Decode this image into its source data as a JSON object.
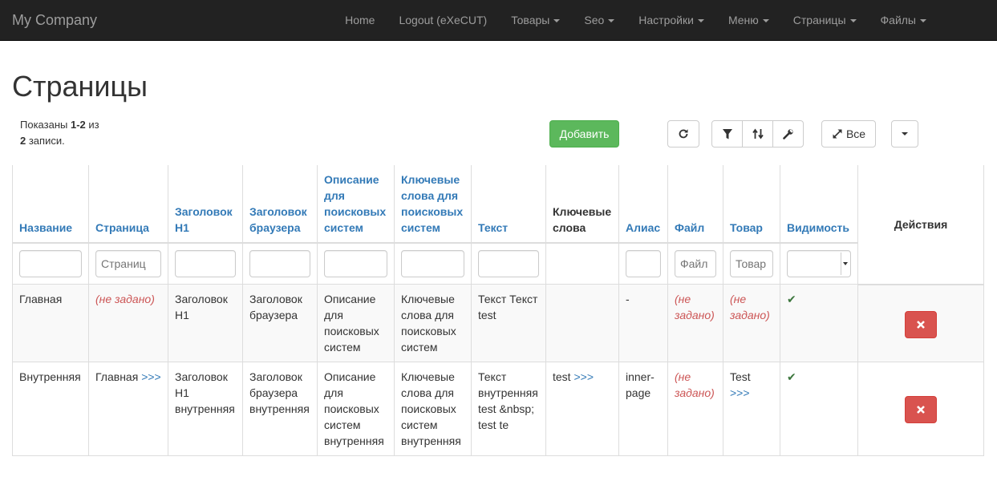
{
  "navbar": {
    "brand": "My Company",
    "items": [
      {
        "label": "Home",
        "caret": false
      },
      {
        "label": "Logout (eXeCUT)",
        "caret": false
      },
      {
        "label": "Товары",
        "caret": true
      },
      {
        "label": "Seo",
        "caret": true
      },
      {
        "label": "Настройки",
        "caret": true
      },
      {
        "label": "Меню",
        "caret": true
      },
      {
        "label": "Страницы",
        "caret": true
      },
      {
        "label": "Файлы",
        "caret": true
      }
    ]
  },
  "page": {
    "title": "Страницы",
    "summary_prefix": "Показаны ",
    "summary_range": "1-2",
    "summary_mid": " из",
    "summary_total": "2",
    "summary_suffix": " записи."
  },
  "toolbar": {
    "add_label": "Добавить",
    "all_label": "Все",
    "icons": [
      "refresh-icon",
      "filter-icon",
      "sort-icon",
      "wrench-icon",
      "expand-icon",
      "caret-down-icon"
    ]
  },
  "table": {
    "headers": [
      "Название",
      "Страница",
      "Заголовок H1",
      "Заголовок браузера",
      "Описание для поисковых систем",
      "Ключевые слова для поисковых систем",
      "Текст",
      "Ключевые слова",
      "Алиас",
      "Файл",
      "Товар",
      "Видимость",
      "Действия"
    ],
    "filters": {
      "page_placeholder": "Страниц",
      "file_placeholder": "Файл",
      "product_placeholder": "Товар"
    },
    "not_set": "(не задано)",
    "link_more": ">>>",
    "rows": [
      {
        "name": "Главная",
        "page": "",
        "h1": "Заголовок H1",
        "browser_title": "Заголовок браузера",
        "description": "Описание для поисковых систем",
        "keywords_seo": "Ключевые слова для поисковых систем",
        "text": "Текст Текст test",
        "keywords": "",
        "alias": "-",
        "file": "",
        "product": "",
        "visible": "✔"
      },
      {
        "name": "Внутренняя",
        "page": "Главная",
        "h1": "Заголовок H1 внутренняя",
        "browser_title": "Заголовок браузера внутренняя",
        "description": "Описание для поисковых систем внутренняя",
        "keywords_seo": "Ключевые слова для поисковых систем внутренняя",
        "text": "Текст внутренняя test &nbsp; test te",
        "keywords": "test",
        "alias": "inner-page",
        "file": "",
        "product": "Test",
        "visible": "✔"
      }
    ]
  },
  "colors": {
    "navbar_bg": "#222222",
    "link": "#337ab7",
    "success": "#5cb85c",
    "danger": "#d9534f",
    "not_set": "#cc5555",
    "check": "#3c763d"
  }
}
